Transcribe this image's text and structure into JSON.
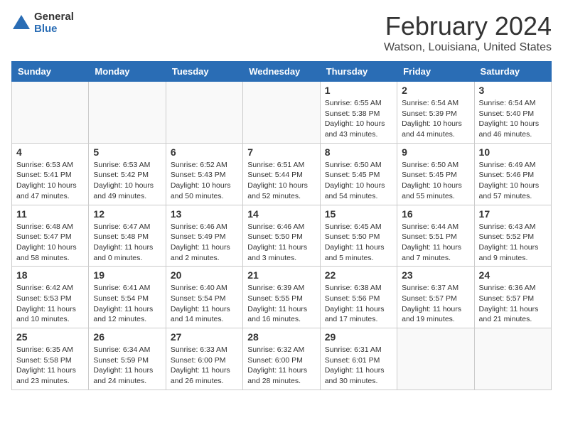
{
  "header": {
    "logo": {
      "general": "General",
      "blue": "Blue"
    },
    "month_year": "February 2024",
    "location": "Watson, Louisiana, United States"
  },
  "weekdays": [
    "Sunday",
    "Monday",
    "Tuesday",
    "Wednesday",
    "Thursday",
    "Friday",
    "Saturday"
  ],
  "weeks": [
    [
      {
        "day": "",
        "info": ""
      },
      {
        "day": "",
        "info": ""
      },
      {
        "day": "",
        "info": ""
      },
      {
        "day": "",
        "info": ""
      },
      {
        "day": "1",
        "info": "Sunrise: 6:55 AM\nSunset: 5:38 PM\nDaylight: 10 hours\nand 43 minutes."
      },
      {
        "day": "2",
        "info": "Sunrise: 6:54 AM\nSunset: 5:39 PM\nDaylight: 10 hours\nand 44 minutes."
      },
      {
        "day": "3",
        "info": "Sunrise: 6:54 AM\nSunset: 5:40 PM\nDaylight: 10 hours\nand 46 minutes."
      }
    ],
    [
      {
        "day": "4",
        "info": "Sunrise: 6:53 AM\nSunset: 5:41 PM\nDaylight: 10 hours\nand 47 minutes."
      },
      {
        "day": "5",
        "info": "Sunrise: 6:53 AM\nSunset: 5:42 PM\nDaylight: 10 hours\nand 49 minutes."
      },
      {
        "day": "6",
        "info": "Sunrise: 6:52 AM\nSunset: 5:43 PM\nDaylight: 10 hours\nand 50 minutes."
      },
      {
        "day": "7",
        "info": "Sunrise: 6:51 AM\nSunset: 5:44 PM\nDaylight: 10 hours\nand 52 minutes."
      },
      {
        "day": "8",
        "info": "Sunrise: 6:50 AM\nSunset: 5:45 PM\nDaylight: 10 hours\nand 54 minutes."
      },
      {
        "day": "9",
        "info": "Sunrise: 6:50 AM\nSunset: 5:45 PM\nDaylight: 10 hours\nand 55 minutes."
      },
      {
        "day": "10",
        "info": "Sunrise: 6:49 AM\nSunset: 5:46 PM\nDaylight: 10 hours\nand 57 minutes."
      }
    ],
    [
      {
        "day": "11",
        "info": "Sunrise: 6:48 AM\nSunset: 5:47 PM\nDaylight: 10 hours\nand 58 minutes."
      },
      {
        "day": "12",
        "info": "Sunrise: 6:47 AM\nSunset: 5:48 PM\nDaylight: 11 hours\nand 0 minutes."
      },
      {
        "day": "13",
        "info": "Sunrise: 6:46 AM\nSunset: 5:49 PM\nDaylight: 11 hours\nand 2 minutes."
      },
      {
        "day": "14",
        "info": "Sunrise: 6:46 AM\nSunset: 5:50 PM\nDaylight: 11 hours\nand 3 minutes."
      },
      {
        "day": "15",
        "info": "Sunrise: 6:45 AM\nSunset: 5:50 PM\nDaylight: 11 hours\nand 5 minutes."
      },
      {
        "day": "16",
        "info": "Sunrise: 6:44 AM\nSunset: 5:51 PM\nDaylight: 11 hours\nand 7 minutes."
      },
      {
        "day": "17",
        "info": "Sunrise: 6:43 AM\nSunset: 5:52 PM\nDaylight: 11 hours\nand 9 minutes."
      }
    ],
    [
      {
        "day": "18",
        "info": "Sunrise: 6:42 AM\nSunset: 5:53 PM\nDaylight: 11 hours\nand 10 minutes."
      },
      {
        "day": "19",
        "info": "Sunrise: 6:41 AM\nSunset: 5:54 PM\nDaylight: 11 hours\nand 12 minutes."
      },
      {
        "day": "20",
        "info": "Sunrise: 6:40 AM\nSunset: 5:54 PM\nDaylight: 11 hours\nand 14 minutes."
      },
      {
        "day": "21",
        "info": "Sunrise: 6:39 AM\nSunset: 5:55 PM\nDaylight: 11 hours\nand 16 minutes."
      },
      {
        "day": "22",
        "info": "Sunrise: 6:38 AM\nSunset: 5:56 PM\nDaylight: 11 hours\nand 17 minutes."
      },
      {
        "day": "23",
        "info": "Sunrise: 6:37 AM\nSunset: 5:57 PM\nDaylight: 11 hours\nand 19 minutes."
      },
      {
        "day": "24",
        "info": "Sunrise: 6:36 AM\nSunset: 5:57 PM\nDaylight: 11 hours\nand 21 minutes."
      }
    ],
    [
      {
        "day": "25",
        "info": "Sunrise: 6:35 AM\nSunset: 5:58 PM\nDaylight: 11 hours\nand 23 minutes."
      },
      {
        "day": "26",
        "info": "Sunrise: 6:34 AM\nSunset: 5:59 PM\nDaylight: 11 hours\nand 24 minutes."
      },
      {
        "day": "27",
        "info": "Sunrise: 6:33 AM\nSunset: 6:00 PM\nDaylight: 11 hours\nand 26 minutes."
      },
      {
        "day": "28",
        "info": "Sunrise: 6:32 AM\nSunset: 6:00 PM\nDaylight: 11 hours\nand 28 minutes."
      },
      {
        "day": "29",
        "info": "Sunrise: 6:31 AM\nSunset: 6:01 PM\nDaylight: 11 hours\nand 30 minutes."
      },
      {
        "day": "",
        "info": ""
      },
      {
        "day": "",
        "info": ""
      }
    ]
  ]
}
